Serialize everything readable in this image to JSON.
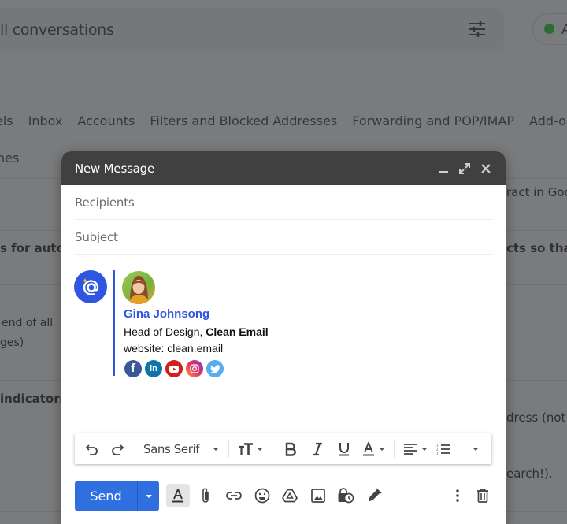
{
  "background": {
    "search_text": "ll conversations",
    "status_text": "A",
    "status_color": "#2d6b35",
    "settings_tabs": [
      "els",
      "Inbox",
      "Accounts",
      "Filters and Blocked Addresses",
      "Forwarding and POP/IMAP",
      "Add-o"
    ],
    "sub_tab": "nes",
    "left_snippets": [
      "s for auto-",
      "end of all",
      "ges)",
      "indicators:"
    ],
    "right_snippets": [
      "ract in Goo",
      "cts so that",
      "dress (not",
      "earch!)."
    ]
  },
  "compose": {
    "title": "New Message",
    "header_icons": [
      "minimize-icon",
      "expand-icon",
      "close-icon"
    ],
    "recipients_placeholder": "Recipients",
    "subject_placeholder": "Subject",
    "signature": {
      "name": "Gina Johnsong",
      "role": "Head of Design, ",
      "company": "Clean Email",
      "website_label": "website: ",
      "website": "clean.email",
      "accent_color": "#2f56e0",
      "socials": [
        {
          "name": "facebook",
          "glyph": "f",
          "color": "#3b5998"
        },
        {
          "name": "linkedin",
          "glyph": "in",
          "color": "#0e76a8"
        },
        {
          "name": "youtube",
          "glyph": "▶",
          "color": "#d31e1e"
        },
        {
          "name": "instagram",
          "glyph": "◎",
          "color": "#c13584"
        },
        {
          "name": "twitter",
          "glyph": "t",
          "color": "#55acee"
        }
      ]
    },
    "format_toolbar": {
      "font": "Sans Serif",
      "items": [
        "undo",
        "redo",
        "font",
        "text-size",
        "bold",
        "italic",
        "underline",
        "text-color",
        "align",
        "numbered-list",
        "more-formatting"
      ]
    },
    "send_label": "Send",
    "send_color": "#2f6fe0",
    "actions": [
      "formatting-options",
      "attach-files",
      "insert-link",
      "insert-emoji",
      "insert-drive",
      "insert-photo",
      "confidential-mode",
      "insert-signature",
      "more-options",
      "discard-draft"
    ]
  }
}
